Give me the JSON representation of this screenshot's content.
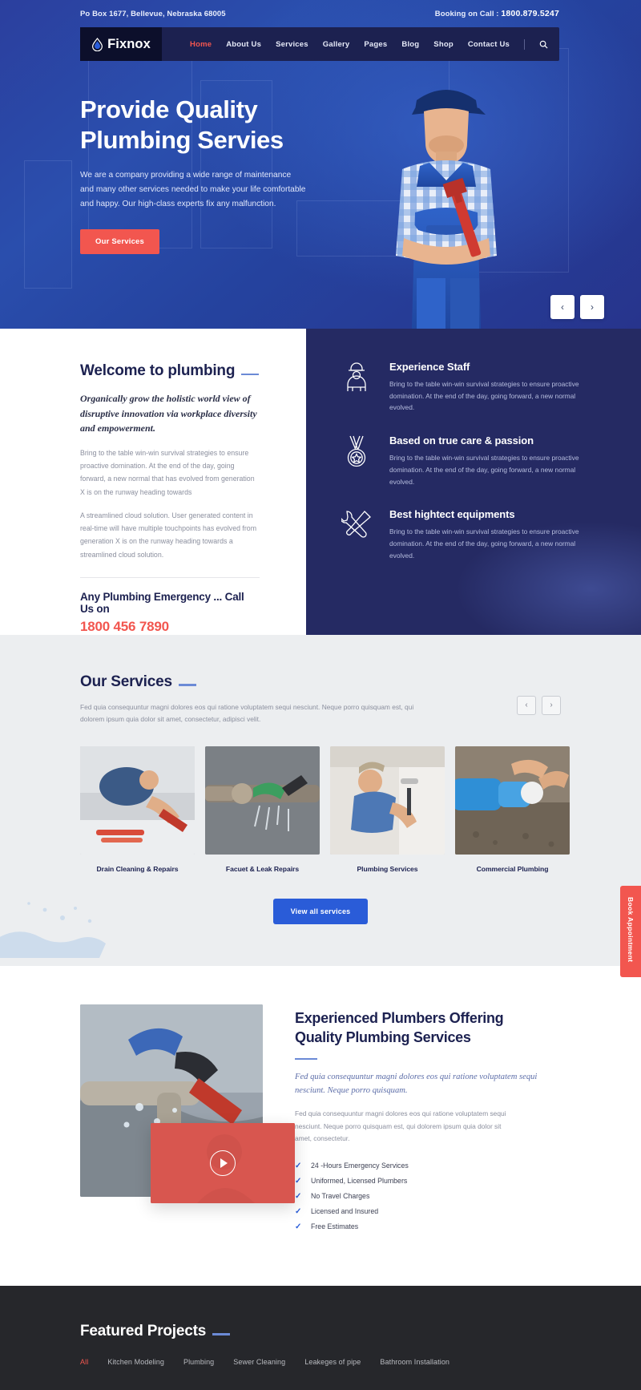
{
  "topbar": {
    "address": "Po Box 1677, Bellevue, Nebraska 68005",
    "booking_label": "Booking on Call :",
    "booking_phone": "1800.879.5247"
  },
  "brand": {
    "name": "Fixnox",
    "logo_icon": "water-drop-icon"
  },
  "nav": {
    "items": [
      {
        "label": "Home",
        "active": true
      },
      {
        "label": "About Us",
        "active": false
      },
      {
        "label": "Services",
        "active": false
      },
      {
        "label": "Gallery",
        "active": false
      },
      {
        "label": "Pages",
        "active": false
      },
      {
        "label": "Blog",
        "active": false
      },
      {
        "label": "Shop",
        "active": false
      },
      {
        "label": "Contact Us",
        "active": false
      }
    ],
    "search_icon": "search-icon"
  },
  "hero": {
    "title_line1": "Provide Quality",
    "title_line2": "Plumbing Servies",
    "paragraph": "We are a company providing a wide range of maintenance and many other services needed to make your life comfortable and happy. Our high-class experts fix any malfunction.",
    "cta": "Our Services",
    "prev_icon": "chevron-left-icon",
    "next_icon": "chevron-right-icon"
  },
  "welcome": {
    "title": "Welcome to plumbing",
    "lead": "Organically grow the holistic world view of disruptive innovation via workplace diversity and empowerment.",
    "para1": "Bring to the table win-win survival strategies to ensure proactive domination. At the end of the day, going forward, a new normal that has evolved from generation X is on the runway heading towards",
    "para2": "A streamlined cloud solution. User generated content in real-time will have multiple touchpoints has evolved from generation X is on the runway heading towards a streamlined cloud solution.",
    "emergency_title": "Any Plumbing Emergency ... Call Us on",
    "emergency_phone": "1800 456 7890"
  },
  "features": [
    {
      "icon": "worker-helmet-icon",
      "title": "Experience Staff",
      "text": "Bring to the table win-win survival strategies to ensure proactive domination. At the end of the day, going forward, a new normal evolved."
    },
    {
      "icon": "medal-icon",
      "title": "Based on true care & passion",
      "text": "Bring to the table win-win survival strategies to ensure proactive domination. At the end of the day, going forward, a new normal evolved."
    },
    {
      "icon": "wrench-screwdriver-icon",
      "title": "Best hightect equipments",
      "text": "Bring to the table win-win survival strategies to ensure proactive domination. At the end of the day, going forward, a new normal evolved."
    }
  ],
  "services": {
    "title": "Our Services",
    "description": "Fed quia consequuntur magni dolores eos qui ratione voluptatem sequi nesciunt. Neque porro quisquam est, qui dolorem ipsum quia dolor sit amet, consectetur, adipisci velit.",
    "prev_icon": "chevron-left-icon",
    "next_icon": "chevron-right-icon",
    "cards": [
      {
        "caption": "Drain Cleaning & Repairs"
      },
      {
        "caption": "Facuet & Leak Repairs"
      },
      {
        "caption": "Plumbing Services"
      },
      {
        "caption": "Commercial Plumbing"
      }
    ],
    "cta": "View all services"
  },
  "experienced": {
    "heading_line1": "Experienced Plumbers Offering",
    "heading_line2": "Quality Plumbing Services",
    "italic": "Fed quia consequuntur magni dolores eos qui ratione voluptatem sequi nesciunt. Neque porro quisquam.",
    "paragraph": "Fed quia consequuntur magni dolores eos qui ratione voluptatem sequi nesciunt. Neque porro quisquam est, qui dolorem ipsum quia dolor sit amet, consectetur.",
    "play_icon": "play-icon",
    "checklist": [
      "24 -Hours Emergency Services",
      "Uniformed, Licensed Plumbers",
      "No Travel Charges",
      "Licensed and Insured",
      "Free Estimates"
    ]
  },
  "book_tab": {
    "label": "Book Appointment"
  },
  "projects": {
    "title": "Featured Projects",
    "filters": [
      {
        "label": "All",
        "active": true
      },
      {
        "label": "Kitchen Modeling",
        "active": false
      },
      {
        "label": "Plumbing",
        "active": false
      },
      {
        "label": "Sewer Cleaning",
        "active": false
      },
      {
        "label": "Leakeges of pipe",
        "active": false
      },
      {
        "label": "Bathroom Installation",
        "active": false
      }
    ]
  },
  "colors": {
    "accent_red": "#f2564f",
    "accent_blue": "#2a5cd8",
    "navy": "#1c2150",
    "dark_footer": "#26272b"
  }
}
